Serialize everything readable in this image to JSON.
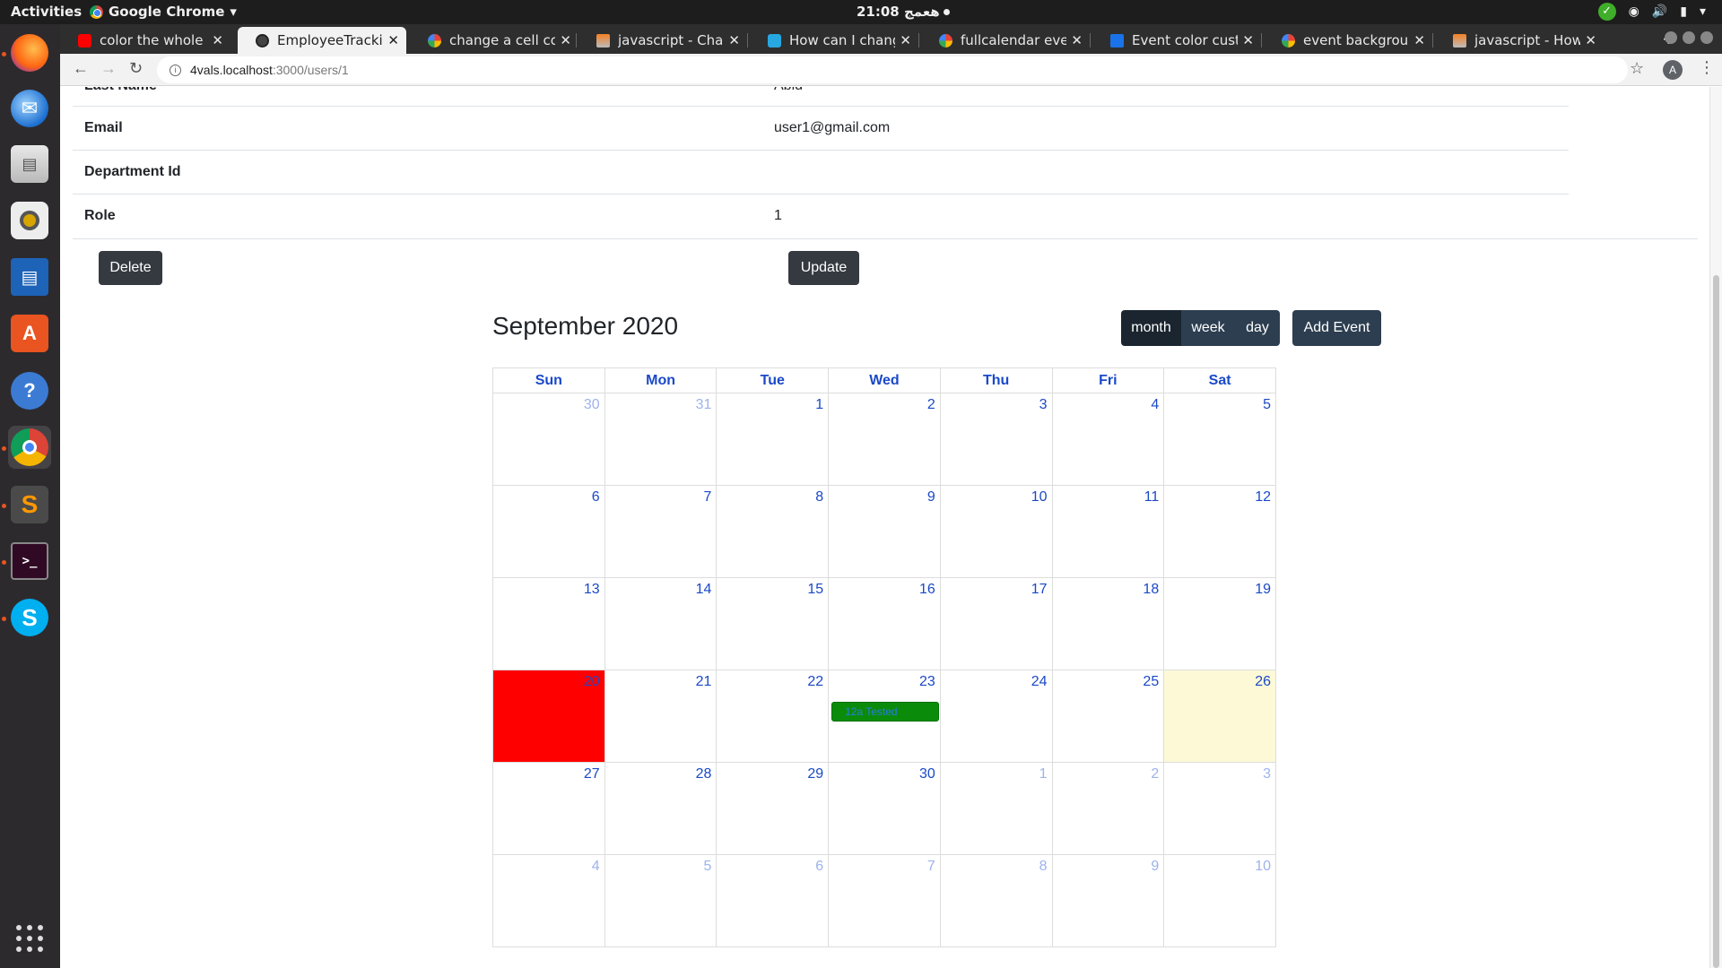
{
  "system": {
    "activities": "Activities",
    "app_name": "Google Chrome",
    "clock": "21:08 هعمج"
  },
  "browser": {
    "tabs": [
      {
        "title": "color the whole ce",
        "favicon": "youtube-icon"
      },
      {
        "title": "EmployeeTracking",
        "favicon": "globe-icon",
        "active": true
      },
      {
        "title": "change a cell color",
        "favicon": "google-icon"
      },
      {
        "title": "javascript - Chang",
        "favicon": "stackoverflow-icon"
      },
      {
        "title": "How can I change",
        "favicon": "doc-icon"
      },
      {
        "title": "fullcalendar event",
        "favicon": "google-icon"
      },
      {
        "title": "Event color custo",
        "favicon": "doc-icon"
      },
      {
        "title": "event background",
        "favicon": "google-icon"
      },
      {
        "title": "javascript - How d",
        "favicon": "stackoverflow-icon"
      }
    ],
    "url_host": "4vals.localhost",
    "url_path": ":3000/users/1",
    "profile_initial": "A"
  },
  "details": {
    "last_name_label": "Last Name",
    "last_name_value": "Abid",
    "email_label": "Email",
    "email_value": "user1@gmail.com",
    "department_label": "Department Id",
    "department_value": "",
    "role_label": "Role",
    "role_value": "1"
  },
  "actions": {
    "delete": "Delete",
    "update": "Update"
  },
  "calendar": {
    "title": "September 2020",
    "views": [
      "month",
      "week",
      "day"
    ],
    "active_view": "month",
    "add_event": "Add Event",
    "weekdays": [
      "Sun",
      "Mon",
      "Tue",
      "Wed",
      "Thu",
      "Fri",
      "Sat"
    ],
    "weeks": [
      [
        {
          "d": "30",
          "o": true
        },
        {
          "d": "31",
          "o": true
        },
        {
          "d": "1"
        },
        {
          "d": "2"
        },
        {
          "d": "3"
        },
        {
          "d": "4"
        },
        {
          "d": "5"
        }
      ],
      [
        {
          "d": "6"
        },
        {
          "d": "7"
        },
        {
          "d": "8"
        },
        {
          "d": "9"
        },
        {
          "d": "10"
        },
        {
          "d": "11"
        },
        {
          "d": "12"
        }
      ],
      [
        {
          "d": "13"
        },
        {
          "d": "14"
        },
        {
          "d": "15"
        },
        {
          "d": "16"
        },
        {
          "d": "17"
        },
        {
          "d": "18"
        },
        {
          "d": "19"
        }
      ],
      [
        {
          "d": "20",
          "red": true
        },
        {
          "d": "21"
        },
        {
          "d": "22"
        },
        {
          "d": "23",
          "event": "12a Tested"
        },
        {
          "d": "24"
        },
        {
          "d": "25"
        },
        {
          "d": "26",
          "today": true
        }
      ],
      [
        {
          "d": "27"
        },
        {
          "d": "28"
        },
        {
          "d": "29"
        },
        {
          "d": "30"
        },
        {
          "d": "1",
          "o": true
        },
        {
          "d": "2",
          "o": true
        },
        {
          "d": "3",
          "o": true
        }
      ],
      [
        {
          "d": "4",
          "o": true
        },
        {
          "d": "5",
          "o": true
        },
        {
          "d": "6",
          "o": true
        },
        {
          "d": "7",
          "o": true
        },
        {
          "d": "8",
          "o": true
        },
        {
          "d": "9",
          "o": true
        },
        {
          "d": "10",
          "o": true
        }
      ]
    ],
    "colors": {
      "day_number": "#1a49c8",
      "highlighted_cell": "#ff0000",
      "today": "#fdf9d6",
      "event_bg": "#0a8c0a"
    }
  }
}
